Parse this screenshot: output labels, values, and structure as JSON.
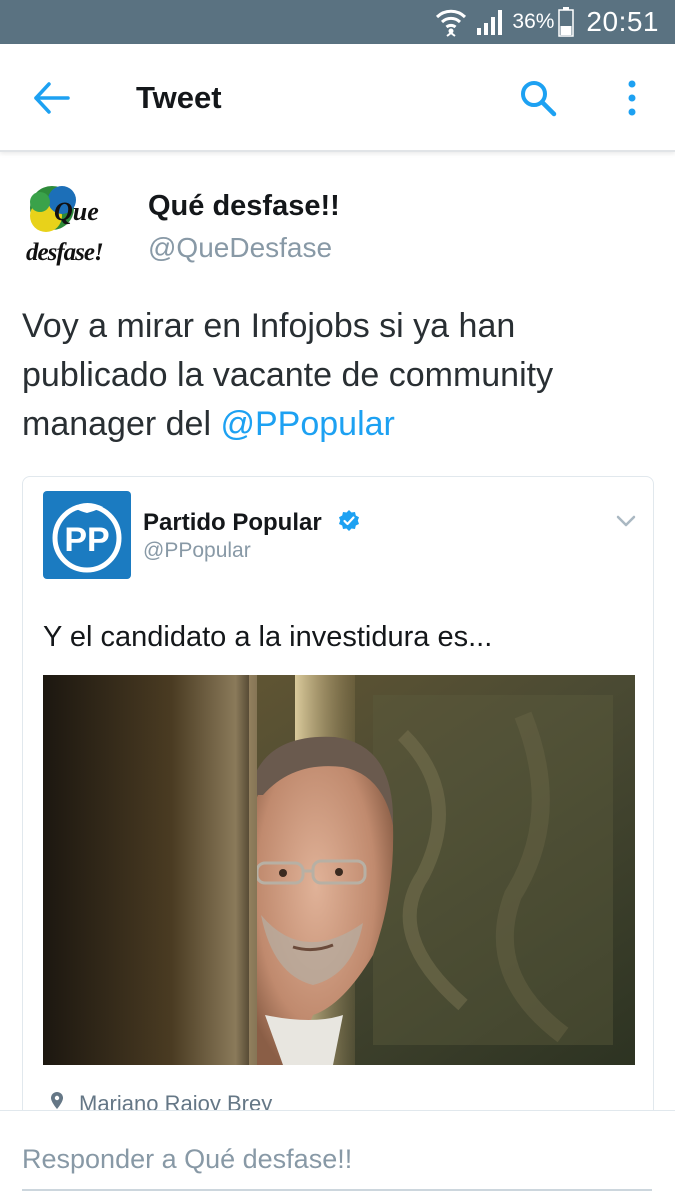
{
  "status_bar": {
    "battery_percent": "36%",
    "time": "20:51",
    "icons": [
      "wifi-icon",
      "signal-icon",
      "battery-icon"
    ]
  },
  "app_bar": {
    "title": "Tweet",
    "icons": [
      "back-arrow-icon",
      "search-icon",
      "more-vertical-icon"
    ],
    "accent_color": "#1da1f2"
  },
  "tweet": {
    "display_name": "Qué desfase!!",
    "handle": "@QueDesfase",
    "avatar_text": {
      "line1": "Que",
      "line2": "desfase!"
    },
    "text_before": "Voy a mirar en Infojobs si ya han publicado la vacante de community manager del ",
    "mention": "@PPopular"
  },
  "quoted_tweet": {
    "display_name": "Partido Popular",
    "handle": "@PPopular",
    "verified": true,
    "logo_text": "PP",
    "brand_color": "#1b7bc1",
    "text": "Y el candidato a la investidura es...",
    "location": "Mariano Rajoy Brey"
  },
  "reply": {
    "placeholder": "Responder a Qué desfase!!"
  }
}
